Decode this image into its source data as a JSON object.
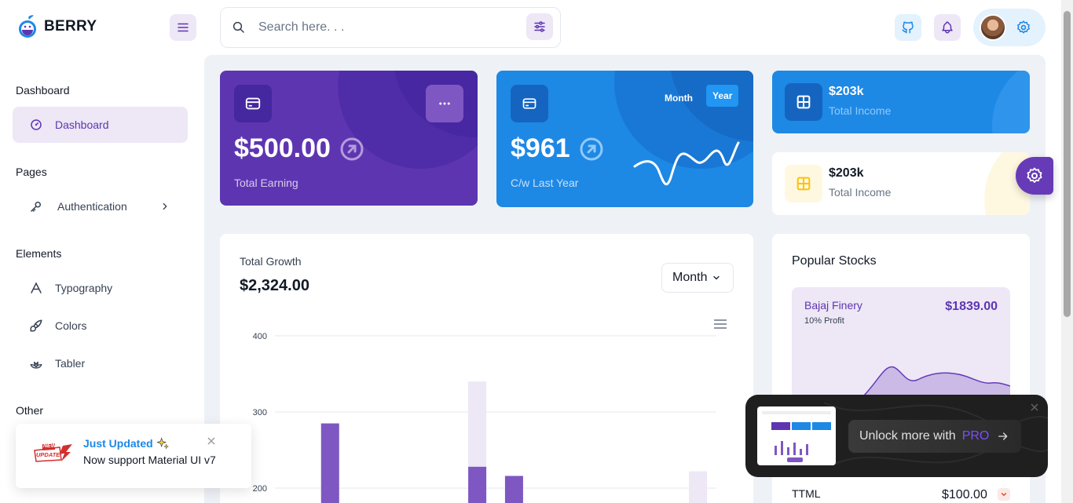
{
  "brand": {
    "name": "BERRY"
  },
  "search": {
    "placeholder": "Search here. . ."
  },
  "sidebar": {
    "sections": [
      {
        "title": "Dashboard"
      },
      {
        "title": "Pages"
      },
      {
        "title": "Elements"
      },
      {
        "title": "Other"
      }
    ],
    "items": {
      "dashboard": "Dashboard",
      "authentication": "Authentication",
      "typography": "Typography",
      "colors": "Colors",
      "tabler": "Tabler"
    }
  },
  "cards": {
    "earning": {
      "amount": "$500.00",
      "label": "Total Earning"
    },
    "cw": {
      "amount": "$961",
      "label": "C/w Last Year",
      "toggle_month": "Month",
      "toggle_year": "Year"
    },
    "income1": {
      "amount": "$203k",
      "label": "Total Income"
    },
    "income2": {
      "amount": "$203k",
      "label": "Total Income"
    }
  },
  "growth": {
    "title": "Total Growth",
    "amount": "$2,324.00",
    "period_select": "Month"
  },
  "stocks": {
    "title": "Popular Stocks",
    "featured": {
      "name": "Bajaj Finery",
      "sub": "10% Profit",
      "price": "$1839.00"
    },
    "rows": [
      {
        "name": "TTML",
        "price": "$100.00"
      }
    ]
  },
  "toast": {
    "title": "Just Updated",
    "message": "Now support Material UI v7",
    "badge_top": "NEW",
    "badge_bottom": "UPDATE!"
  },
  "promo": {
    "label": "Unlock more with",
    "highlight": "PRO"
  },
  "colors": {
    "primary": "#5e35b1",
    "secondary": "#1e88e5",
    "warning": "#ffc107"
  },
  "chart_data": {
    "type": "bar",
    "yticks": [
      400,
      300,
      200
    ],
    "ylim": [
      200,
      400
    ],
    "categories": [
      "",
      "",
      "",
      "",
      "",
      "",
      "",
      "",
      "",
      "",
      "",
      ""
    ],
    "series": [
      {
        "values": [
          0,
          285,
          0,
          0,
          0,
          228,
          216,
          0,
          0,
          0,
          0,
          0
        ]
      },
      {
        "values": [
          0,
          0,
          0,
          0,
          0,
          340,
          0,
          0,
          0,
          0,
          0,
          222
        ]
      }
    ]
  }
}
